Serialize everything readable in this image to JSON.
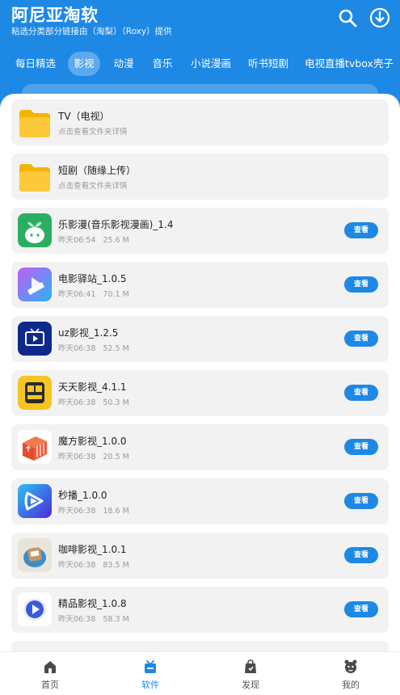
{
  "header": {
    "title": "阿尼亚淘软",
    "subtitle": "粘选分类部分链接由（淘梨）（Roxy）提供"
  },
  "tabs": [
    {
      "label": "每日精选"
    },
    {
      "label": "影视"
    },
    {
      "label": "动漫"
    },
    {
      "label": "音乐"
    },
    {
      "label": "小说漫画"
    },
    {
      "label": "听书短剧"
    },
    {
      "label": "电视直播tvbox壳子"
    }
  ],
  "active_tab": "影视",
  "folders": [
    {
      "name": "TV（电视）",
      "hint": "点击查看文件夹详情",
      "icon": "folder-icon"
    },
    {
      "name": "短剧（随缘上传）",
      "hint": "点击查看文件夹详情",
      "icon": "folder-icon"
    }
  ],
  "apps": [
    {
      "name": "乐影漫(音乐影视漫画)_1.4",
      "time": "昨天06:54",
      "size": "25.6 M",
      "button": "查看",
      "icon": "leyingman-app-icon",
      "color": "#2aae62"
    },
    {
      "name": "电影驿站_1.0.5",
      "time": "昨天06:41",
      "size": "70.1 M",
      "button": "查看",
      "icon": "dianyingyizhan-app-icon",
      "color": "#8a5cf6"
    },
    {
      "name": "uz影视_1.2.5",
      "time": "昨天06:38",
      "size": "52.5 M",
      "button": "查看",
      "icon": "uz-tv-app-icon",
      "color": "#0d2a8a"
    },
    {
      "name": "天天影视_4.1.1",
      "time": "昨天06:38",
      "size": "50.3 M",
      "button": "查看",
      "icon": "tiantian-app-icon",
      "color": "#f6c520"
    },
    {
      "name": "魔方影视_1.0.0",
      "time": "昨天06:38",
      "size": "20.5 M",
      "button": "查看",
      "icon": "mofang-app-icon",
      "color": "#f05a3c"
    },
    {
      "name": "秒播_1.0.0",
      "time": "昨天06:38",
      "size": "18.6 M",
      "button": "查看",
      "icon": "miaobo-app-icon",
      "color": "#3d4ee8"
    },
    {
      "name": "咖啡影视_1.0.1",
      "time": "昨天06:38",
      "size": "83.5 M",
      "button": "查看",
      "icon": "kafei-app-icon",
      "color": "#e8e4da"
    },
    {
      "name": "精品影视_1.0.8",
      "time": "昨天06:38",
      "size": "58.3 M",
      "button": "查看",
      "icon": "jingpin-app-icon",
      "color": "#ffffff"
    }
  ],
  "bottom_nav": [
    {
      "label": "首页",
      "icon": "home-icon"
    },
    {
      "label": "软件",
      "icon": "software-icon"
    },
    {
      "label": "发现",
      "icon": "discover-icon"
    },
    {
      "label": "我的",
      "icon": "profile-icon"
    }
  ],
  "active_nav": "软件",
  "colors": {
    "accent": "#1e88e5",
    "folder": "#fcc93a",
    "card_bg": "#f2f2f2"
  }
}
